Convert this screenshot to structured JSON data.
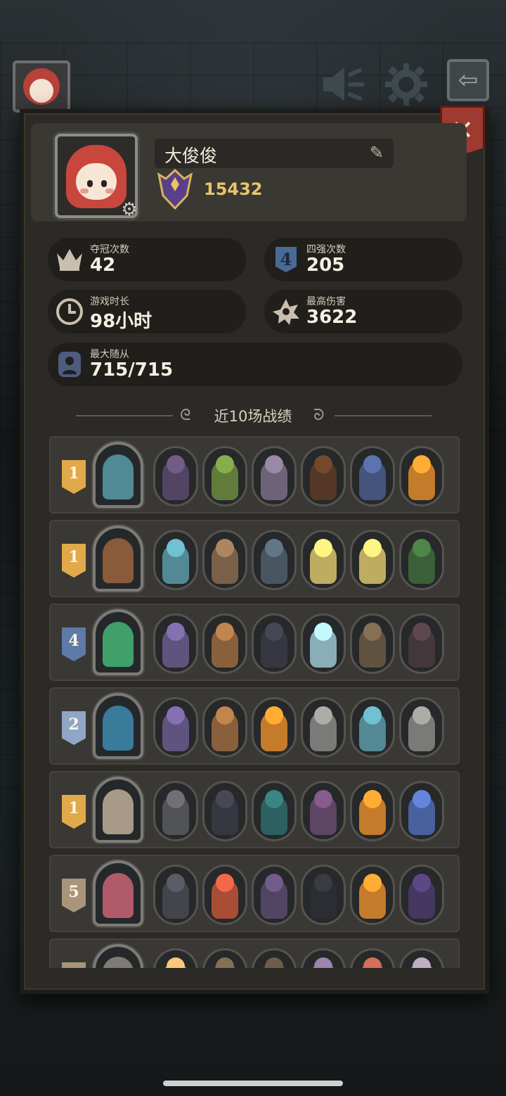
{
  "player": {
    "name": "大俊俊",
    "score": "15432"
  },
  "stats": [
    {
      "label": "夺冠次数",
      "value": "42",
      "icon": "crown-icon"
    },
    {
      "label": "四强次数",
      "value": "205",
      "icon": "top4-icon"
    },
    {
      "label": "游戏时长",
      "value": "98小时",
      "icon": "clock-icon"
    },
    {
      "label": "最高伤害",
      "value": "3622",
      "icon": "damage-burst-icon"
    },
    {
      "label": "最大随从",
      "value": "715/715",
      "icon": "minion-icon"
    }
  ],
  "section": {
    "title": "近10场战绩"
  },
  "matches": [
    {
      "place": "1",
      "badge_color": "#e1a94a",
      "hero_color": "#4f8a95",
      "units": [
        "#5b4a6e",
        "#6b8a3e",
        "#7a6d86",
        "#5d3a24",
        "#4a5c8c",
        "#e08a2a"
      ]
    },
    {
      "place": "1",
      "badge_color": "#e1a94a",
      "hero_color": "#8a5a3a",
      "units": [
        "#5a9aa8",
        "#8a6a4e",
        "#4f5e6b",
        "#d9c46a",
        "#d9c46a",
        "#3f6a3a"
      ]
    },
    {
      "place": "4",
      "badge_color": "#5d7aa8",
      "hero_color": "#3fa06a",
      "units": [
        "#6a5a8e",
        "#9a6a3e",
        "#3a3a44",
        "#9cc6d0",
        "#6a5a44",
        "#4a3a3e"
      ]
    },
    {
      "place": "2",
      "badge_color": "#8fa6c6",
      "hero_color": "#3a7a9a",
      "units": [
        "#6a5a8e",
        "#9a6a3e",
        "#e08a2a",
        "#8a8a86",
        "#5a9aa8",
        "#8a8a86"
      ]
    },
    {
      "place": "1",
      "badge_color": "#e1a94a",
      "hero_color": "#a89a86",
      "units": [
        "#5a5a5e",
        "#3a3a44",
        "#2f6a6a",
        "#6a4a6e",
        "#e08a2a",
        "#4f6ab0"
      ]
    },
    {
      "place": "5",
      "badge_color": "#a8957a",
      "hero_color": "#b05a6a",
      "units": [
        "#4a4a52",
        "#c2533a",
        "#5b4a6e",
        "#2e2e34",
        "#e08a2a",
        "#4a3a6a"
      ]
    },
    {
      "place": "",
      "badge_color": "#a8957a",
      "hero_color": "#7d7b76",
      "units": [
        "#c8a060",
        "#6a5a44",
        "#5a4a3a",
        "#7a6a8a",
        "#a85a4a",
        "#9a8a9a"
      ]
    }
  ]
}
